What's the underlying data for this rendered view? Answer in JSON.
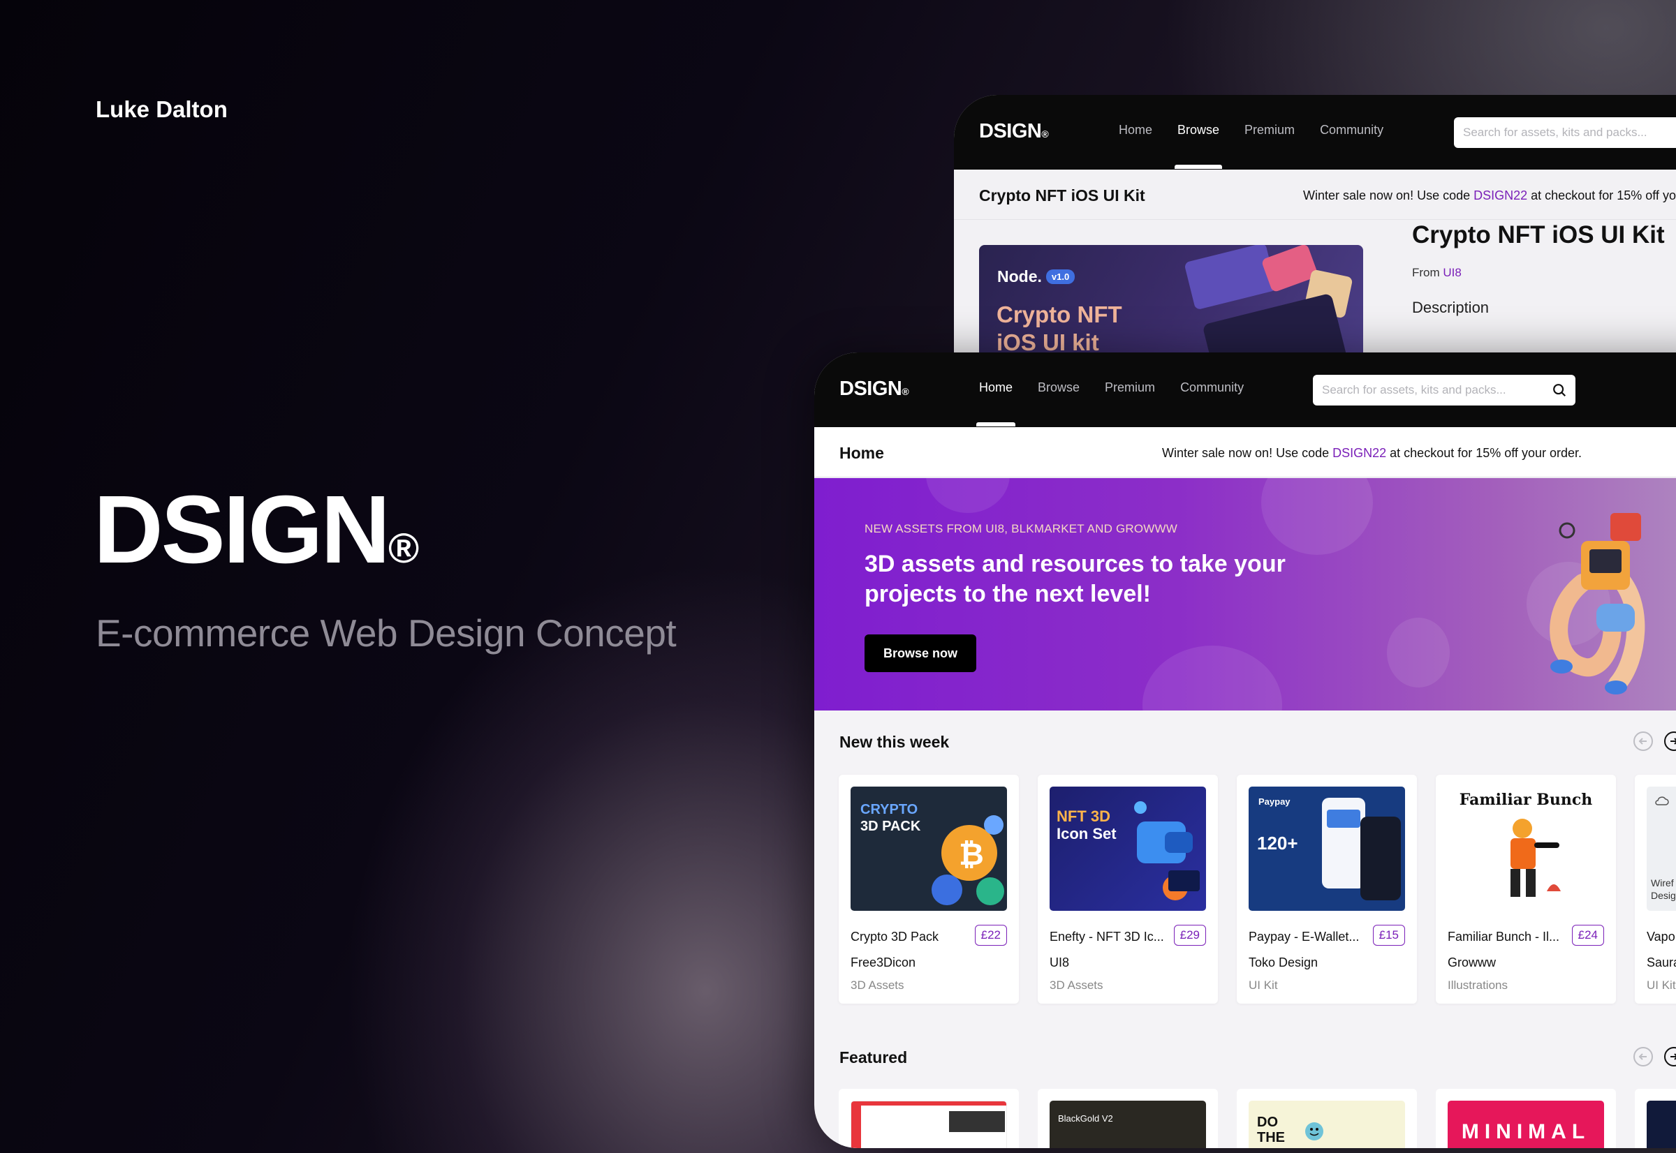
{
  "author": "Luke Dalton",
  "brand": {
    "name": "DSIGN",
    "reg": "®"
  },
  "tagline": "E-commerce Web Design Concept",
  "colors": {
    "accent": "#7a1fb8",
    "hero_start": "#7f1ecf",
    "hero_end": "#b08cc0",
    "topbar": "#0a0a0a"
  },
  "back_window": {
    "logo": "DSIGN",
    "logo_reg": "®",
    "nav": [
      "Home",
      "Browse",
      "Premium",
      "Community"
    ],
    "active_nav": "Browse",
    "search_placeholder": "Search for assets, kits and packs...",
    "page_title": "Crypto NFT iOS UI Kit",
    "promo": {
      "before": "Winter sale now on! Use code ",
      "code": "DSIGN22",
      "after": " at checkout for 15% off yo"
    },
    "product": {
      "node": "Node.",
      "badge": "v1.0",
      "image_title_1": "Crypto NFT",
      "image_title_2": "iOS UI kit",
      "name": "Crypto NFT iOS UI Kit",
      "from_label": "From ",
      "vendor": "UI8",
      "description_label": "Description"
    }
  },
  "front_window": {
    "logo": "DSIGN",
    "logo_reg": "®",
    "nav": [
      "Home",
      "Browse",
      "Premium",
      "Community"
    ],
    "active_nav": "Home",
    "search_placeholder": "Search for assets, kits and packs...",
    "page_title": "Home",
    "promo": {
      "before": "Winter sale now on! Use code ",
      "code": "DSIGN22",
      "after": " at checkout for 15% off your order."
    },
    "hero": {
      "kicker": "NEW ASSETS FROM UI8, BLKMARKET AND GROWWW",
      "title": "3D assets and resources to take your projects to the next level!",
      "button": "Browse now"
    },
    "new_this_week": {
      "title": "New this week",
      "cards": [
        {
          "name": "Crypto 3D Pack",
          "price": "£22",
          "vendor": "Free3Dicon",
          "category": "3D Assets",
          "thumb_line1": "CRYPTO",
          "thumb_line2": "3D PACK",
          "thumb_icon": "bitcoin-coin-icon"
        },
        {
          "name": "Enefty - NFT 3D Ic...",
          "price": "£29",
          "vendor": "UI8",
          "category": "3D Assets",
          "thumb_line1": "NFT 3D",
          "thumb_line2": "Icon Set",
          "thumb_icon": "wallet-3d-icon"
        },
        {
          "name": "Paypay - E-Wallet...",
          "price": "£15",
          "vendor": "Toko Design",
          "category": "UI Kit",
          "thumb_line1": "Paypay",
          "thumb_line2": "120+",
          "thumb_icon": "phone-mockup-icon"
        },
        {
          "name": "Familiar Bunch - Il...",
          "price": "£24",
          "vendor": "Growww",
          "category": "Illustrations",
          "thumb_line1": "Familiar Bunch",
          "thumb_line2": "",
          "thumb_icon": "firefighter-illustration-icon"
        },
        {
          "name": "Vapo",
          "price": "",
          "vendor": "Saura",
          "category": "UI Kit",
          "thumb_line1": "Wiref",
          "thumb_line2": "Desig",
          "thumb_icon": "cloud-icon"
        }
      ]
    },
    "featured": {
      "title": "Featured",
      "cards": [
        {
          "thumb_text": ""
        },
        {
          "thumb_text": "BlackGold V2"
        },
        {
          "thumb_text": "DO THE"
        },
        {
          "thumb_text": "MINIMAL"
        },
        {
          "thumb_text": ""
        }
      ]
    }
  }
}
